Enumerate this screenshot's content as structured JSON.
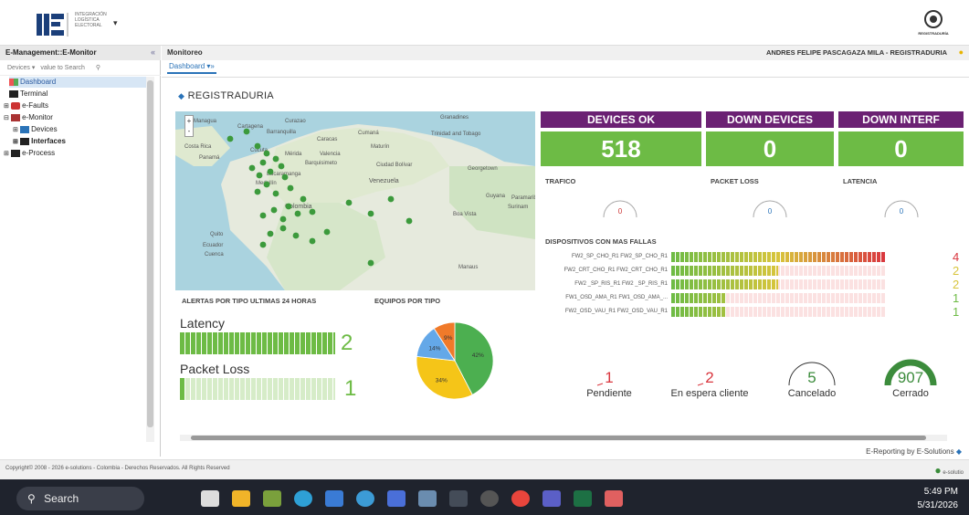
{
  "header": {
    "logo_text": "INTEGRACIÓN LOGÍSTICA ELECTORAL",
    "caret": "▾",
    "registraduria_label": "REGISTRADURÍA"
  },
  "left_panel": {
    "title": "E-Management::E-Monitor",
    "collapse": "«",
    "search_filter": "Devices ▾",
    "search_placeholder": "value to Search",
    "tree": [
      {
        "label": "Dashboard",
        "selected": true
      },
      {
        "label": "Terminal"
      },
      {
        "label": "e-Faults"
      },
      {
        "label": "e-Monitor"
      },
      {
        "label": "Devices"
      },
      {
        "label": "Interfaces"
      },
      {
        "label": "e-Process"
      }
    ]
  },
  "main": {
    "title": "Monitoreo",
    "user": "ANDRES FELIPE PASCAGAZA MILA - REGISTRADURIA",
    "tab": "Dashboard ▾»",
    "section_title": "REGISTRADURIA"
  },
  "map": {
    "zoom_in": "+",
    "zoom_out": "-",
    "labels": [
      "Managua",
      "Cartagena",
      "Curazao",
      "Barranquilla",
      "Caracas",
      "Cumaná",
      "Granadines",
      "Trinidad and Tobago",
      "Costa Rica",
      "Cúcuta",
      "Mérida",
      "Valencia",
      "Maturín",
      "Panamá",
      "Barquisimeto",
      "Ciudad Bolívar",
      "Georgetown",
      "Bucaramanga",
      "Medellín",
      "Venezuela",
      "Colombia",
      "Guyana",
      "Surinam",
      "Paramaribo",
      "Boa Vista",
      "Quito",
      "Ecuador",
      "Cuenca",
      "Manaus"
    ]
  },
  "kpis": {
    "devices_ok_label": "DEVICES OK",
    "devices_ok_value": "518",
    "down_devices_label": "DOWN DEVICES",
    "down_devices_value": "0",
    "down_interf_label": "DOWN INTERF",
    "down_interf_value": "0",
    "header_color": "#6b2173",
    "value_color": "#6dbb45"
  },
  "gauges": [
    {
      "label": "TRAFICO",
      "value": "0"
    },
    {
      "label": "PACKET LOSS",
      "value": "0"
    },
    {
      "label": "LATENCIA",
      "value": "0"
    }
  ],
  "fallas": {
    "title": "DISPOSITIVOS CON MAS FALLAS",
    "rows": [
      {
        "name": "FW2_SP_CHO_R1 FW2_SP_CHO_R1",
        "count": "4",
        "level": 1.0,
        "color": "#d9363e"
      },
      {
        "name": "FW2_CRT_CHO_R1 FW2_CRT_CHO_R1",
        "count": "2",
        "level": 0.5,
        "color": "#d8c53c"
      },
      {
        "name": "FW2 _SP_RIS_R1 FW2 _SP_RIS_R1",
        "count": "2",
        "level": 0.5,
        "color": "#d8c53c"
      },
      {
        "name": "FW1_OSD_AMA_R1 FW1_OSD_AMA_...",
        "count": "1",
        "level": 0.25,
        "color": "#6dbb45"
      },
      {
        "name": "FW2_OSD_VAU_R1 FW2_OSD_VAU_R1",
        "count": "1",
        "level": 0.25,
        "color": "#6dbb45"
      }
    ]
  },
  "alertas": {
    "title": "ALERTAS POR TIPO ULTIMAS 24 HORAS",
    "items": [
      {
        "label": "Latency",
        "count": "2",
        "level": 1.0
      },
      {
        "label": "Packet Loss",
        "count": "1",
        "level": 0.5
      }
    ]
  },
  "equipos": {
    "title": "EQUIPOS POR TIPO",
    "chart_data": {
      "type": "pie",
      "values": [
        42,
        34,
        14,
        9
      ],
      "labels": [
        "42%",
        "34%",
        "14%",
        "9%"
      ],
      "colors": [
        "#4caf50",
        "#f5c518",
        "#64a8e8",
        "#f07a2a"
      ]
    }
  },
  "status": [
    {
      "value": "1",
      "label": "Pendiente",
      "color": "#d9363e"
    },
    {
      "value": "2",
      "label": "En espera cliente",
      "color": "#d9363e"
    },
    {
      "value": "5",
      "label": "Cancelado",
      "color": "#3c8c3c"
    },
    {
      "value": "907",
      "label": "Cerrado",
      "color": "#3c8c3c"
    }
  ],
  "ereporting": "E-Reporting by E-Solutions",
  "footer": {
    "copyright": "Copyright© 2008 - 2026 e-solutions - Colombia - Derechos Reservados. All Rights Reserved",
    "brand": "e-solutio"
  },
  "taskbar": {
    "search": "Search",
    "time": "5:49 PM",
    "date": "5/31/2026"
  }
}
